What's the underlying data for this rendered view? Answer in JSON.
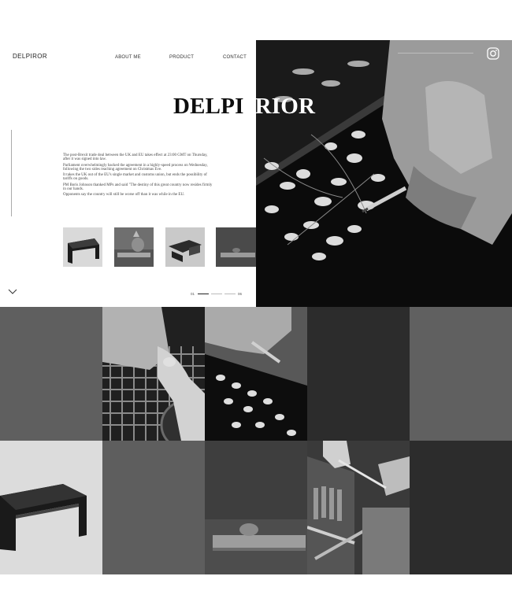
{
  "brand": {
    "logo": "DELPIROR"
  },
  "nav": {
    "about": "ABOUT ME",
    "product": "PRODUCT",
    "contact": "CONTACT"
  },
  "hero": {
    "title_left": "DELPI",
    "title_right": "RIOR",
    "paragraphs": [
      "The post-Brexit trade deal between the UK and EU takes effect at 23:00 GMT on Thursday, after it was signed into law.",
      "Parliament overwhelmingly backed the agreement in a highly-speed process on Wednesday, following the two sides reaching agreement on Christmas Eve.",
      "It takes the UK out of the EU's single market and customs union, but ends the possibility of tariffs on goods.",
      "PM Boris Johnson thanked MPs and said \"The destiny of this great country now resides firmly in our hands.",
      "Opponents say the country will still be worse off than it was while in the EU."
    ],
    "pager": {
      "current": "01",
      "total": "06"
    }
  },
  "icons": {
    "social": "instagram-icon",
    "scroll": "chevron-down-icon"
  },
  "colors": {
    "background": "#ffffff",
    "text": "#111111",
    "grid_gray": "#5f5f5f",
    "grid_dark": "#2a2a2a"
  }
}
